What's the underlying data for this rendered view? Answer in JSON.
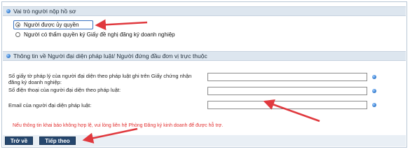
{
  "role_section": {
    "title": "Vai trò người nộp hồ sơ",
    "options": [
      {
        "label": "Người được ủy quyền",
        "selected": true
      },
      {
        "label": "Người có thẩm quyền ký Giấy đề nghị đăng ký doanh nghiệp",
        "selected": false
      }
    ]
  },
  "rep_section": {
    "title": "Thông tin về Người đại diện pháp luật/ Người đứng đầu đơn vị trực thuộc",
    "fields": [
      {
        "label": "Số giấy tờ pháp lý của người đại diện theo pháp luật ghi trên Giấy chứng nhận đăng ký doanh nghiệp:",
        "value": ""
      },
      {
        "label": "Số điện thoại của người đại diện theo pháp luật:",
        "value": ""
      },
      {
        "label": "Email của người đại diện pháp luật:",
        "value": ""
      }
    ]
  },
  "notice": "Nếu thông tin khai báo không hợp lệ, vui lòng liên hệ Phòng Đăng ký kinh doanh để được hỗ trợ.",
  "buttons": {
    "back": "Trở về",
    "next": "Tiếp theo"
  },
  "colors": {
    "header_bg": "#dde6ef",
    "button_bg": "#26476e",
    "notice": "#e23030",
    "annotation_arrow": "#e0393e"
  }
}
